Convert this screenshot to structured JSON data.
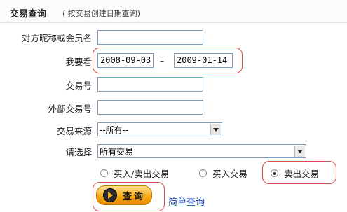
{
  "header": {
    "title": "交易查询",
    "subtitle": "( 按交易创建日期查询)"
  },
  "form": {
    "counterparty_label": "对方昵称或会员名",
    "counterparty_value": "",
    "date_label": "我要看",
    "date_from": "2008-09-03",
    "date_separator": "–",
    "date_to": "2009-01-14",
    "trade_no_label": "交易号",
    "trade_no_value": "",
    "external_no_label": "外部交易号",
    "external_no_value": "",
    "source_label": "交易来源",
    "source_selected": "--所有--",
    "choose_label": "请选择",
    "choose_selected": "所有交易",
    "radios": [
      {
        "label": "买入/卖出交易",
        "checked": false
      },
      {
        "label": "买入交易",
        "checked": false
      },
      {
        "label": "卖出交易",
        "checked": true
      }
    ],
    "search_button": "查询",
    "simple_search_link": "简单查询"
  },
  "colors": {
    "highlight": "#d94a4a",
    "button": "#f6a712",
    "link": "#1b3fb0"
  }
}
